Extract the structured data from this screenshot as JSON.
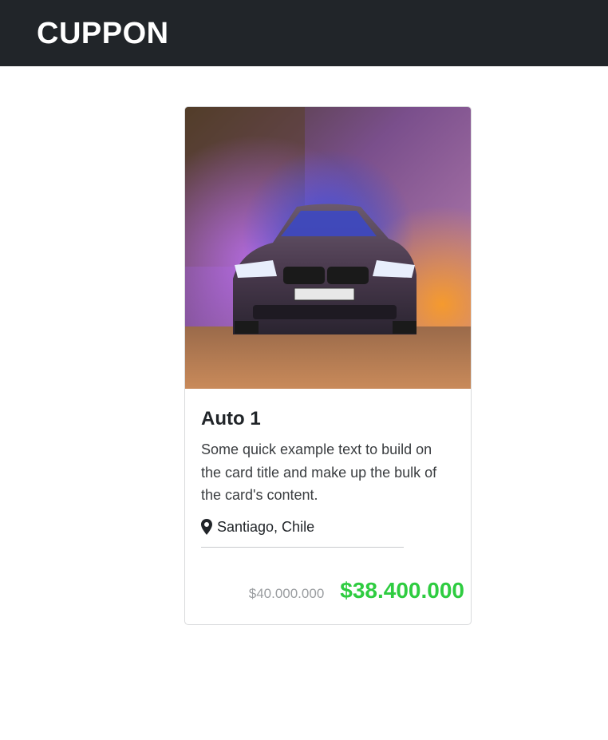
{
  "navbar": {
    "brand": "CUPPON"
  },
  "card": {
    "image_alt": "Purple BMW sedan surrounded by colored smoke",
    "title": "Auto 1",
    "text": "Some quick example text to build on the card title and make up the bulk of the card's content.",
    "location_icon": "map-pin-icon",
    "location": "Santiago, Chile",
    "old_price": "$40.000.000",
    "new_price": "$38.400.000"
  },
  "colors": {
    "navbar_bg": "#212529",
    "new_price": "#2ecc40",
    "old_price": "#9a9da0"
  }
}
